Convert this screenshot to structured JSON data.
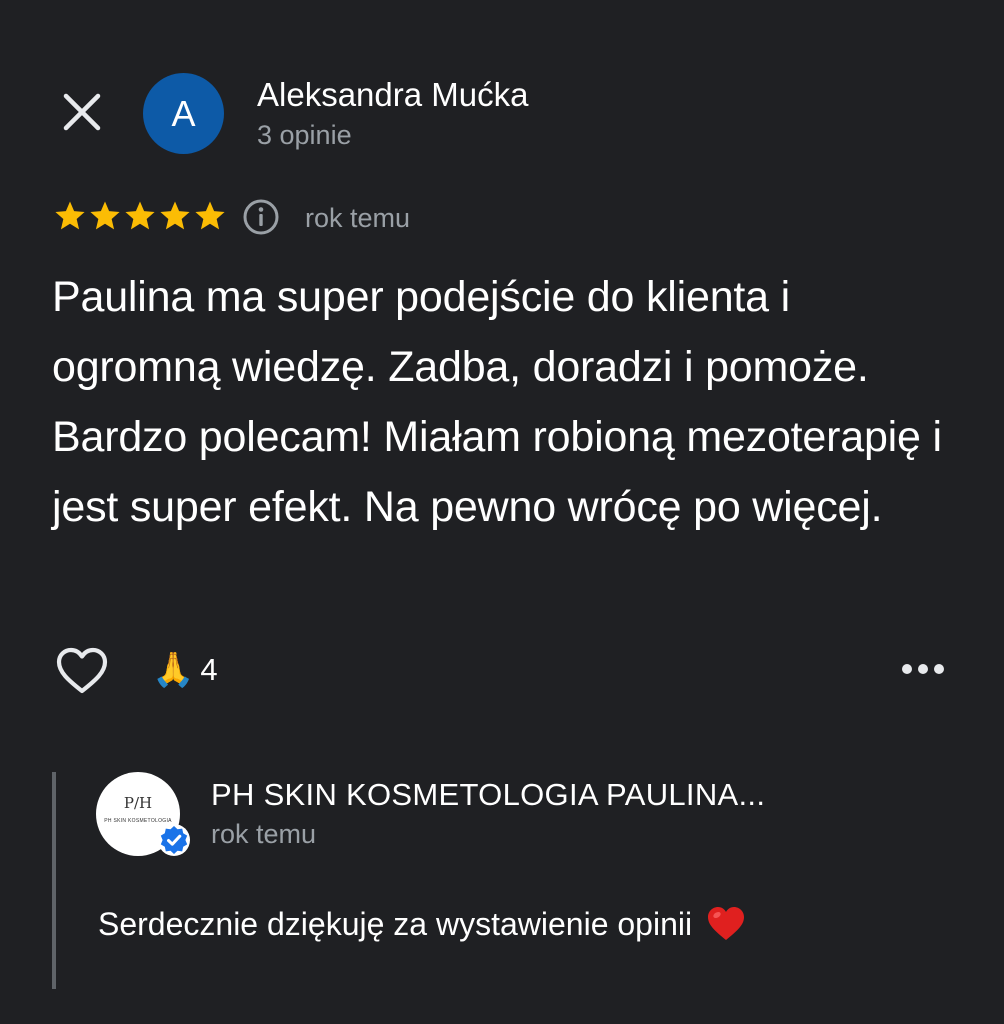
{
  "review": {
    "author_initial": "A",
    "author_name": "Aleksandra Mućka",
    "author_reviews": "3 opinie",
    "rating": 5,
    "rating_max": 5,
    "time": "rok temu",
    "text": "Paulina ma super podejście do klienta i ogromną wiedzę. Zadba, doradzi i pomoże. Bardzo polecam! Miałam robioną mezoterapię i jest super efekt. Na pewno wrócę po więcej.",
    "reaction_emoji": "🙏",
    "reaction_count": "4"
  },
  "owner_reply": {
    "name": "PH SKIN KOSMETOLOGIA PAULINA...",
    "time": "rok temu",
    "logo_monogram": "P/H",
    "logo_text": "PH SKIN KOSMETOLOGIA",
    "text": "Serdecznie dziękuję za wystawienie opinii"
  },
  "icons": {
    "close": "close-icon",
    "star": "star-icon",
    "info": "info-icon",
    "like": "heart-outline-icon",
    "more": "more-horizontal-icon",
    "verified": "verified-badge-icon",
    "heart": "red-heart-emoji"
  },
  "colors": {
    "background": "#1f2023",
    "star": "#fbbc04",
    "avatar": "#0d5aa7",
    "verified": "#1a73e8",
    "secondary_text": "#9aa0a6",
    "heart": "#e0201f"
  }
}
